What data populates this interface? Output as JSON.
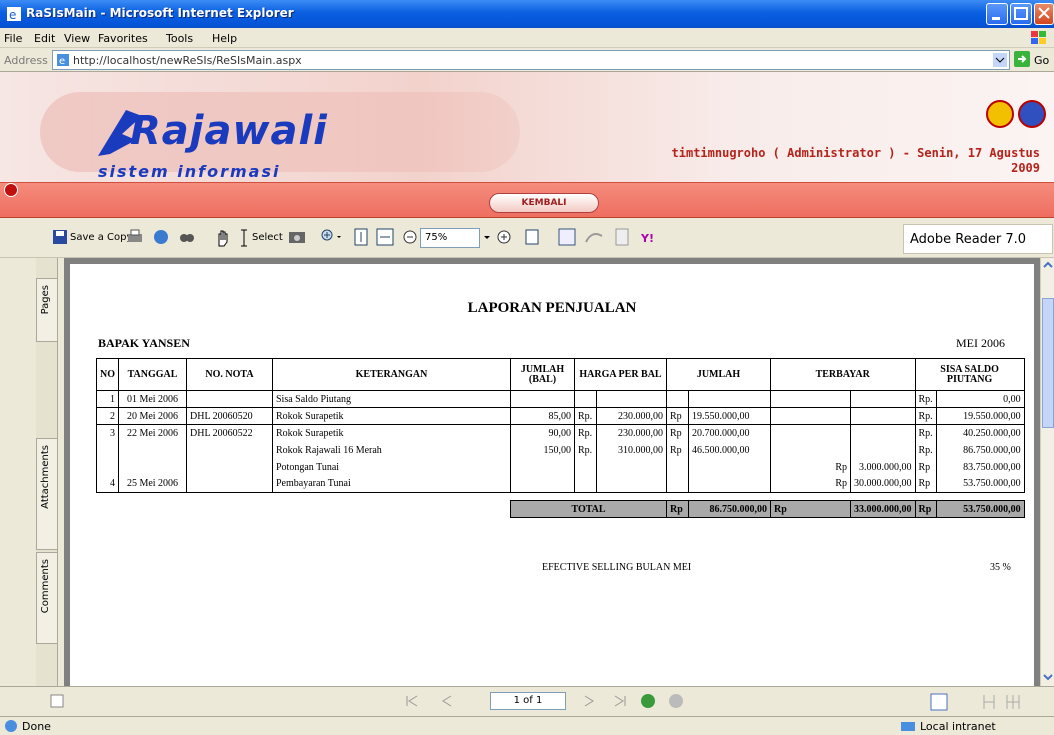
{
  "window": {
    "title": "RaSIsMain - Microsoft Internet Explorer"
  },
  "menu": [
    "File",
    "Edit",
    "View",
    "Favorites",
    "Tools",
    "Help"
  ],
  "address": {
    "label": "Address",
    "url": "http://localhost/newReSIs/ReSIsMain.aspx",
    "go": "Go"
  },
  "banner": {
    "logo_main": "Rajawali",
    "logo_sub": "sistem informasi",
    "user_line1": "timtimnugroho ( Administrator ) - Senin, 17 Agustus",
    "user_line2": "2009"
  },
  "nav": {
    "kembali": "KEMBALI"
  },
  "pdf_toolbar": {
    "save_copy": "Save a Copy",
    "select": "Select",
    "zoom": "75%",
    "brand": "Adobe Reader 7.0"
  },
  "side_tabs": {
    "pages": "Pages",
    "attachments": "Attachments",
    "comments": "Comments"
  },
  "pager": {
    "page": "1 of 1"
  },
  "status": {
    "done": "Done",
    "zone": "Local intranet"
  },
  "report": {
    "title": "LAPORAN PENJUALAN",
    "customer": "BAPAK YANSEN",
    "period": "MEI 2006",
    "headers": [
      "NO",
      "TANGGAL",
      "NO. NOTA",
      "KETERANGAN",
      "JUMLAH (BAL)",
      "HARGA PER BAL",
      "JUMLAH",
      "TERBAYAR",
      "SISA SALDO PIUTANG"
    ],
    "rows": [
      {
        "no": "1",
        "tgl": "01 Mei 2006",
        "nota": "",
        "ket": "Sisa Saldo Piutang",
        "bal": "",
        "rp1": "",
        "harga": "",
        "rp2": "",
        "jumlah": "",
        "rp3": "",
        "bayar": "",
        "rp4": "Rp.",
        "sisa": "0,00"
      },
      {
        "no": "2",
        "tgl": "20 Mei 2006",
        "nota": "DHL 20060520",
        "ket": "Rokok Surapetik",
        "bal": "85,00",
        "rp1": "Rp.",
        "harga": "230.000,00",
        "rp2": "Rp",
        "jumlah": "19.550.000,00",
        "rp3": "",
        "bayar": "",
        "rp4": "Rp.",
        "sisa": "19.550.000,00"
      },
      {
        "no": "3",
        "tgl": "22 Mei 2006",
        "nota": "DHL 20060522",
        "ket": "Rokok Surapetik",
        "bal": "90,00",
        "rp1": "Rp.",
        "harga": "230.000,00",
        "rp2": "Rp",
        "jumlah": "20.700.000,00",
        "rp3": "",
        "bayar": "",
        "rp4": "Rp.",
        "sisa": "40.250.000,00"
      },
      {
        "no": "",
        "tgl": "",
        "nota": "",
        "ket": "Rokok Rajawali 16 Merah",
        "bal": "150,00",
        "rp1": "Rp.",
        "harga": "310.000,00",
        "rp2": "Rp",
        "jumlah": "46.500.000,00",
        "rp3": "",
        "bayar": "",
        "rp4": "Rp.",
        "sisa": "86.750.000,00"
      },
      {
        "no": "",
        "tgl": "",
        "nota": "",
        "ket": "Potongan Tunai",
        "bal": "",
        "rp1": "",
        "harga": "",
        "rp2": "",
        "jumlah": "",
        "rp3": "Rp",
        "bayar": "3.000.000,00",
        "rp4": "Rp",
        "sisa": "83.750.000,00"
      },
      {
        "no": "4",
        "tgl": "25 Mei 2006",
        "nota": "",
        "ket": "Pembayaran Tunai",
        "bal": "",
        "rp1": "",
        "harga": "",
        "rp2": "",
        "jumlah": "",
        "rp3": "Rp",
        "bayar": "30.000.000,00",
        "rp4": "Rp",
        "sisa": "53.750.000,00"
      }
    ],
    "total": {
      "label": "TOTAL",
      "rp1": "Rp",
      "jumlah": "86.750.000,00",
      "rp2": "Rp",
      "bayar": "33.000.000,00",
      "rp3": "Rp",
      "sisa": "53.750.000,00"
    },
    "effective_label": "EFECTIVE SELLING BULAN MEI",
    "effective_value": "35 %"
  }
}
